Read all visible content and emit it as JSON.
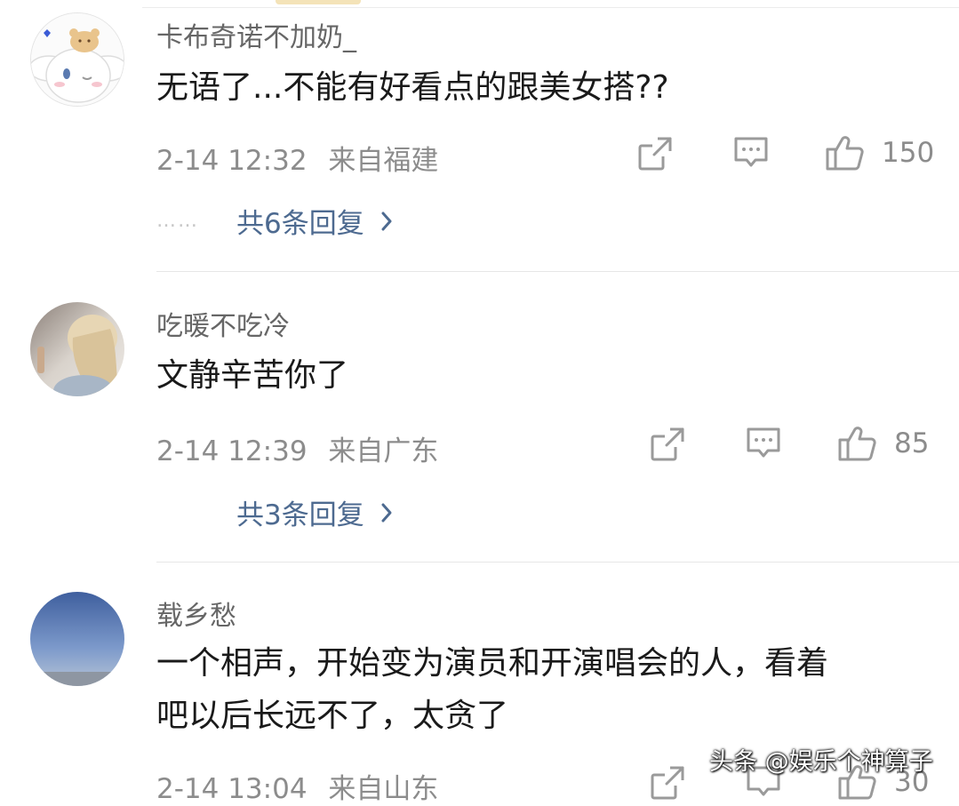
{
  "comments": [
    {
      "author": "卡布奇诺不加奶_",
      "text_lines": [
        "无语了...不能有好看点的跟美女搭??"
      ],
      "time": "2-14 12:32",
      "location": "来自福建",
      "likes": "150",
      "replies": "共6条回复",
      "avatar_icon": "cinnamoroll-avatar"
    },
    {
      "author": "吃暖不吃冷",
      "text_lines": [
        "文静辛苦你了"
      ],
      "time": "2-14 12:39",
      "location": "来自广东",
      "likes": "85",
      "replies": "共3条回复",
      "avatar_icon": "blonde-woman-avatar"
    },
    {
      "author": "载乡愁",
      "text_lines": [
        "一个相声，开始变为演员和开演唱会的人，看着",
        "吧以后长远不了，太贪了"
      ],
      "time": "2-14 13:04",
      "location": "来自山东",
      "likes": "30",
      "avatar_icon": "sky-avatar"
    }
  ],
  "icons": {
    "share": "share-icon",
    "comment": "comment-icon",
    "like": "thumbs-up-icon",
    "more": "chevron-right-icon"
  },
  "colors": {
    "reply_link": "#4d6a90",
    "meta_gray": "#8c8c8c"
  },
  "dots": "……",
  "watermark": "头条 @娱乐个神算子"
}
